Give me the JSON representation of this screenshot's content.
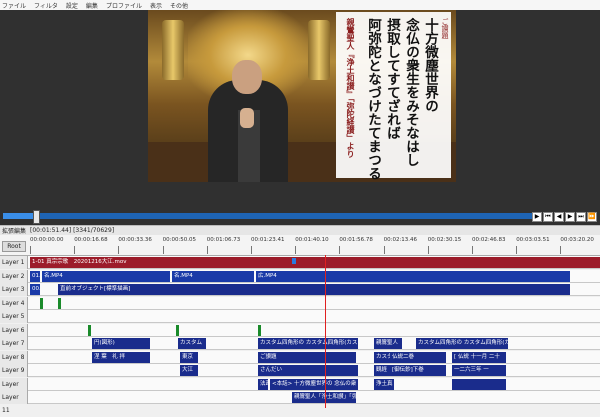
{
  "menu": [
    "ファイル",
    "フィルタ",
    "設定",
    "編集",
    "プロファイル",
    "表示",
    "その他"
  ],
  "caption": {
    "title_small": "ご讃題",
    "line1": "十方微塵世界の",
    "line2": "念仏の衆生をみそなはし",
    "line3": "摂取してすてざれば",
    "line4": "阿弥陀となづけたてまつる",
    "source": "親鸞聖人『浄土和讃』「弥陀経讃」より"
  },
  "transport_icons": [
    "play-icon",
    "prev-icon",
    "step-back-icon",
    "step-forward-icon",
    "next-icon",
    "end-icon"
  ],
  "playback": {
    "progress": 0.06
  },
  "timeline": {
    "title": "拡張編集",
    "time_info": "[00:01:51.44] [3341/70629]",
    "root": "Root",
    "ticks": [
      "00:00:00.00",
      "00:00:16.68",
      "00:00:33.36",
      "00:00:50.05",
      "00:01:06.73",
      "00:01:23.41",
      "00:01:40.10",
      "00:01:56.78",
      "00:02:13.46",
      "00:02:30.15",
      "00:02:46.83",
      "00:03:03.51",
      "00:03:20.20"
    ]
  },
  "layers": [
    {
      "name": "Layer 1",
      "clips": [
        {
          "text": "1-01 真宗宗歌　20201216大江.mov",
          "color": "red"
        }
      ]
    },
    {
      "name": "Layer 2",
      "clips": [
        {
          "text": "01.jpg 動画再生",
          "color": "blue"
        },
        {
          "text": "名.MP4",
          "color": "blue"
        },
        {
          "text": "名.MP4",
          "color": "blue"
        },
        {
          "text": "広.MP4",
          "color": "blue"
        }
      ]
    },
    {
      "name": "Layer 3",
      "clips": [
        {
          "text": "00.jpg",
          "color": "blue"
        },
        {
          "text": "直前オブジェクト[標準描画]",
          "color": "navy"
        }
      ]
    },
    {
      "name": "Layer 4",
      "clips": []
    },
    {
      "name": "Layer 5",
      "clips": []
    },
    {
      "name": "Layer 6",
      "clips": []
    },
    {
      "name": "Layer 7",
      "clips": [
        {
          "text": "円(図形)",
          "color": "navy"
        },
        {
          "text": "カスタム",
          "color": "navy"
        },
        {
          "text": "カスタム四角形の カスタム四角形(カスタムブ",
          "color": "navy"
        },
        {
          "text": "親鸞聖人",
          "color": "navy"
        },
        {
          "text": "カスタム四角形の カスタム四角形(カスタム",
          "color": "navy"
        }
      ]
    },
    {
      "name": "Layer 8",
      "clips": [
        {
          "text": "涅 葉　礼 拝",
          "color": "navy"
        },
        {
          "text": "東京",
          "color": "navy"
        },
        {
          "text": "ご讃題",
          "color": "navy"
        },
        {
          "text": "カスタム",
          "color": "navy"
        },
        {
          "text": "仏説二巻",
          "color": "navy"
        },
        {
          "text": "[ 仏説 十一月 二十",
          "color": "navy"
        }
      ]
    },
    {
      "name": "Layer 9",
      "clips": [
        {
          "text": "大江",
          "color": "navy"
        },
        {
          "text": "さんだい",
          "color": "navy"
        },
        {
          "text": "観経",
          "color": "navy"
        },
        {
          "text": "[御伝鈔]下巻",
          "color": "navy"
        },
        {
          "text": "一二六三年 一",
          "color": "navy"
        }
      ]
    },
    {
      "name": "Layer 10",
      "clips": [
        {
          "text": "法政",
          "color": "navy"
        },
        {
          "text": "<本話> 十方微塵世界の 念仏の衆",
          "color": "navy"
        },
        {
          "text": "浄土真",
          "color": "navy"
        },
        {
          "text": "",
          "color": "navy"
        }
      ]
    },
    {
      "name": "Layer 11",
      "clips": [
        {
          "text": "親鸞聖人「浄土和讃」「弥陀",
          "color": "navy"
        }
      ]
    }
  ]
}
